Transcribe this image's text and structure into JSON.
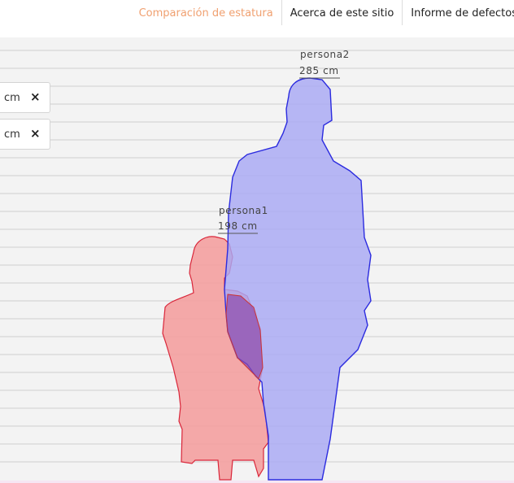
{
  "nav": {
    "items": [
      {
        "label": "Comparación de estatura",
        "active": true
      },
      {
        "label": "Acerca de este sitio",
        "active": false
      },
      {
        "label": "Informe de defectos",
        "active": false
      }
    ]
  },
  "inputs": [
    {
      "unit": "cm",
      "remove_icon": "×"
    },
    {
      "unit": "cm",
      "remove_icon": "×"
    }
  ],
  "figures": [
    {
      "name": "persona1",
      "height_label": "198 cm",
      "color": "#f4a0a0",
      "stroke": "#d9263a"
    },
    {
      "name": "persona2",
      "height_label": "285 cm",
      "color": "#a8a8f4",
      "stroke": "#2b2bdf"
    }
  ],
  "colors": {
    "accent": "#f0a070",
    "background": "#f3f3f3"
  }
}
